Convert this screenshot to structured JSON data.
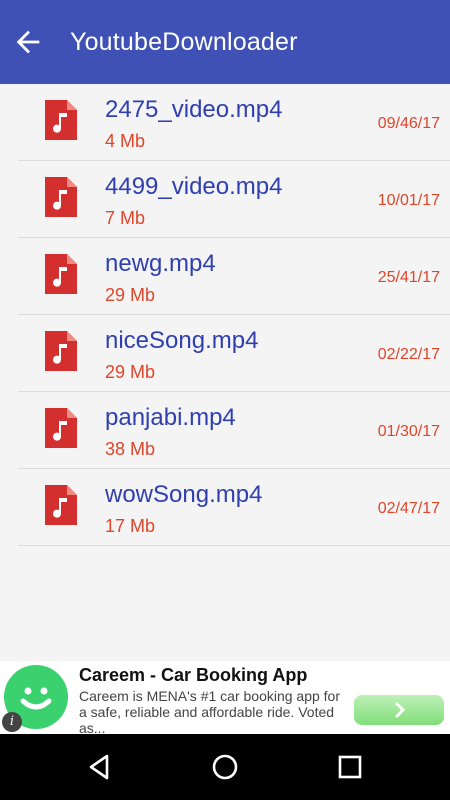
{
  "appbar": {
    "title": "YoutubeDownloader",
    "back_icon": "arrow-left-icon"
  },
  "files": [
    {
      "name": "2475_video.mp4",
      "size": "4 Mb",
      "date": "09/46/17"
    },
    {
      "name": "4499_video.mp4",
      "size": "7 Mb",
      "date": "10/01/17"
    },
    {
      "name": "newg.mp4",
      "size": "29 Mb",
      "date": "25/41/17"
    },
    {
      "name": "niceSong.mp4",
      "size": "29 Mb",
      "date": "02/22/17"
    },
    {
      "name": "panjabi.mp4",
      "size": "38 Mb",
      "date": "01/30/17"
    },
    {
      "name": "wowSong.mp4",
      "size": "17 Mb",
      "date": "02/47/17"
    }
  ],
  "ad": {
    "title": "Careem - Car Booking App",
    "description": "Careem is MENA's #1 car booking app for a safe, reliable and affordable ride. Voted as...",
    "info": "i"
  },
  "colors": {
    "appbar": "#3f51b5",
    "file_name": "#2f3fb0",
    "accent_red": "#e0452a",
    "file_icon": "#d32f2f"
  }
}
